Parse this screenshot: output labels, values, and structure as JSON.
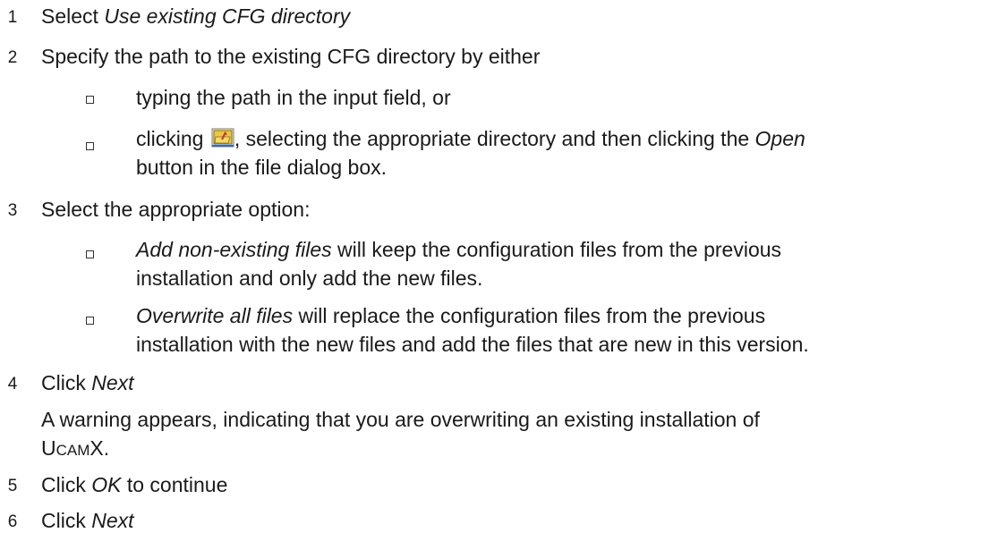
{
  "steps": [
    {
      "num": "1",
      "pre": "Select ",
      "em": "Use existing CFG directory"
    },
    {
      "num": "2",
      "text": "Specify the path to the existing CFG directory by either",
      "bullets": [
        {
          "text": "typing the path in the input field, or"
        },
        {
          "pre": "clicking ",
          "icon": "open-folder-icon",
          "mid": ", selecting the appropriate directory and then clicking the ",
          "em": "Open",
          "line2": "button in the file dialog box."
        }
      ]
    },
    {
      "num": "3",
      "text": "Select the appropriate option:",
      "bullets": [
        {
          "em": "Add non-existing files",
          "rest": " will keep the configuration files from the previous",
          "line2": "installation and only add the new files."
        },
        {
          "em": "Overwrite all files",
          "rest": " will replace the configuration files from the previous",
          "line2": "installation with the new files and add the files that are new in this version."
        }
      ]
    },
    {
      "num": "4",
      "pre": "Click ",
      "em": "Next",
      "para_line1": "A warning appears, indicating that you are overwriting an existing installation of",
      "para_sc_u": "U",
      "para_sc_cam": "CAM",
      "para_sc_x": "X",
      "para_end": "."
    },
    {
      "num": "5",
      "pre": "Click ",
      "em": "OK",
      "post": " to continue"
    },
    {
      "num": "6",
      "pre": "Click ",
      "em": "Next"
    }
  ]
}
